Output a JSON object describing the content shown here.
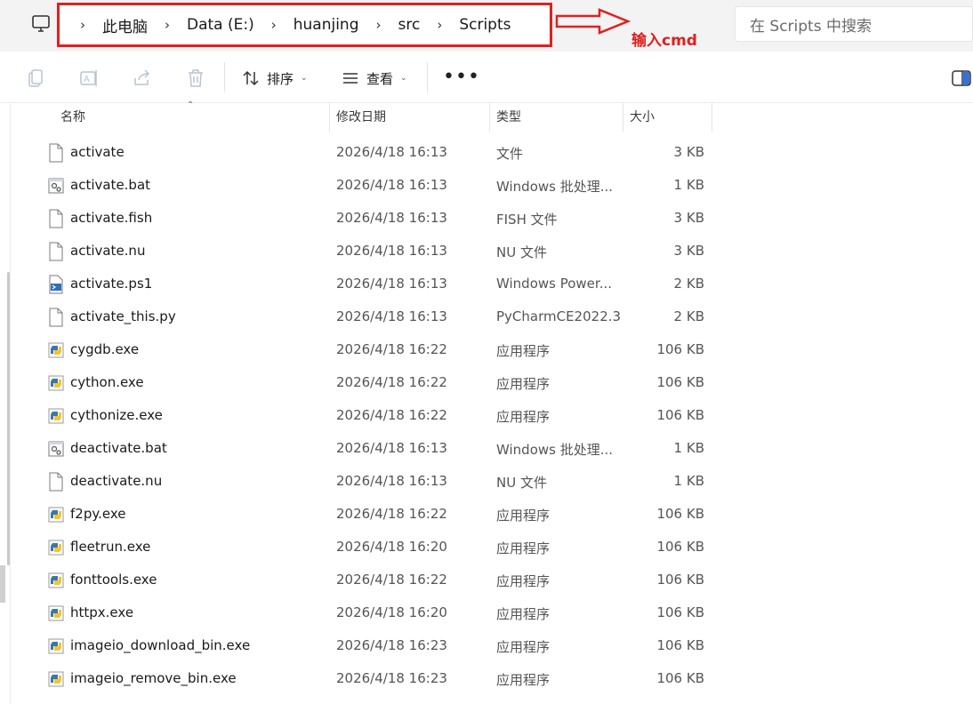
{
  "address_bar": {
    "crumbs": [
      "此电脑",
      "Data (E:)",
      "huanjing",
      "src",
      "Scripts"
    ],
    "annotation": "输入cmd",
    "highlight_color": "#e02020"
  },
  "search": {
    "placeholder": "在 Scripts 中搜索"
  },
  "toolbar": {
    "sort_label": "排序",
    "view_label": "查看",
    "more_label": "•••",
    "icons": [
      "copy-icon",
      "rename-icon",
      "share-icon",
      "delete-icon",
      "sort-icon",
      "view-icon",
      "details-pane-icon"
    ]
  },
  "columns": {
    "name": "名称",
    "date": "修改日期",
    "type": "类型",
    "size": "大小"
  },
  "files": [
    {
      "name": "activate",
      "date": "2026/4/18 16:13",
      "type": "文件",
      "size": "3 KB",
      "icon": "file"
    },
    {
      "name": "activate.bat",
      "date": "2026/4/18 16:13",
      "type": "Windows 批处理...",
      "size": "1 KB",
      "icon": "bat"
    },
    {
      "name": "activate.fish",
      "date": "2026/4/18 16:13",
      "type": "FISH 文件",
      "size": "3 KB",
      "icon": "file"
    },
    {
      "name": "activate.nu",
      "date": "2026/4/18 16:13",
      "type": "NU 文件",
      "size": "3 KB",
      "icon": "file"
    },
    {
      "name": "activate.ps1",
      "date": "2026/4/18 16:13",
      "type": "Windows Power...",
      "size": "2 KB",
      "icon": "ps1"
    },
    {
      "name": "activate_this.py",
      "date": "2026/4/18 16:13",
      "type": "PyCharmCE2022.3",
      "size": "2 KB",
      "icon": "file"
    },
    {
      "name": "cygdb.exe",
      "date": "2026/4/18 16:22",
      "type": "应用程序",
      "size": "106 KB",
      "icon": "python"
    },
    {
      "name": "cython.exe",
      "date": "2026/4/18 16:22",
      "type": "应用程序",
      "size": "106 KB",
      "icon": "python"
    },
    {
      "name": "cythonize.exe",
      "date": "2026/4/18 16:22",
      "type": "应用程序",
      "size": "106 KB",
      "icon": "python"
    },
    {
      "name": "deactivate.bat",
      "date": "2026/4/18 16:13",
      "type": "Windows 批处理...",
      "size": "1 KB",
      "icon": "bat"
    },
    {
      "name": "deactivate.nu",
      "date": "2026/4/18 16:13",
      "type": "NU 文件",
      "size": "1 KB",
      "icon": "file"
    },
    {
      "name": "f2py.exe",
      "date": "2026/4/18 16:22",
      "type": "应用程序",
      "size": "106 KB",
      "icon": "python"
    },
    {
      "name": "fleetrun.exe",
      "date": "2026/4/18 16:20",
      "type": "应用程序",
      "size": "106 KB",
      "icon": "python"
    },
    {
      "name": "fonttools.exe",
      "date": "2026/4/18 16:22",
      "type": "应用程序",
      "size": "106 KB",
      "icon": "python"
    },
    {
      "name": "httpx.exe",
      "date": "2026/4/18 16:20",
      "type": "应用程序",
      "size": "106 KB",
      "icon": "python"
    },
    {
      "name": "imageio_download_bin.exe",
      "date": "2026/4/18 16:23",
      "type": "应用程序",
      "size": "106 KB",
      "icon": "python"
    },
    {
      "name": "imageio_remove_bin.exe",
      "date": "2026/4/18 16:23",
      "type": "应用程序",
      "size": "106 KB",
      "icon": "python"
    }
  ]
}
